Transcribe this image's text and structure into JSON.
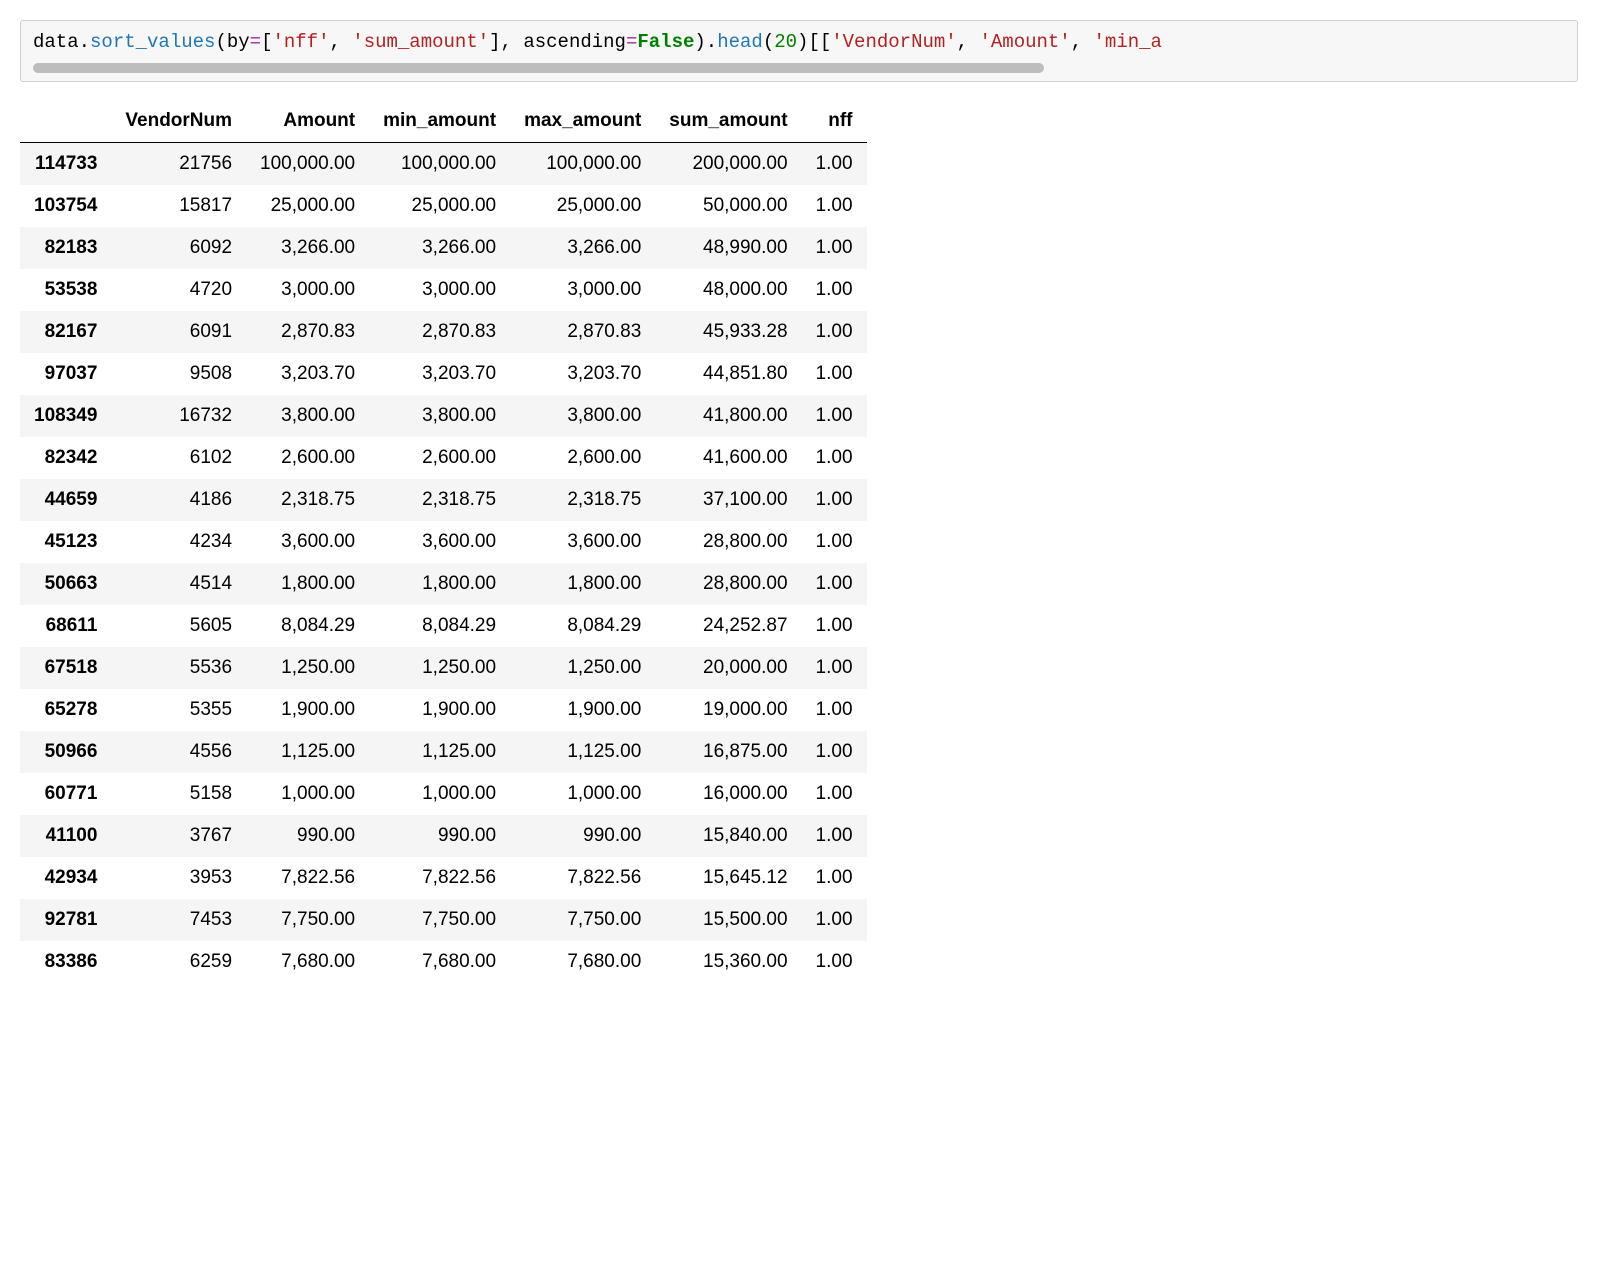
{
  "code": {
    "t_data": "data",
    "t_dot1": ".",
    "t_sort": "sort_values",
    "t_paren1": "(",
    "t_by": "by",
    "t_eq1": "=",
    "t_list1_open": "[",
    "t_str_nff": "'nff'",
    "t_comma1": ", ",
    "t_str_sum": "'sum_amount'",
    "t_list1_close": "]",
    "t_comma2": ", ",
    "t_asc": "ascending",
    "t_eq2": "=",
    "t_false": "False",
    "t_paren1c": ")",
    "t_dot2": ".",
    "t_head": "head",
    "t_paren2": "(",
    "t_20": "20",
    "t_paren2c": ")",
    "t_sel_open": "[[",
    "t_str_vn": "'VendorNum'",
    "t_comma3": ", ",
    "t_str_amt": "'Amount'",
    "t_comma4": ", ",
    "t_str_mina": "'min_a"
  },
  "table": {
    "columns": [
      "VendorNum",
      "Amount",
      "min_amount",
      "max_amount",
      "sum_amount",
      "nff"
    ],
    "rows": [
      {
        "idx": "114733",
        "VendorNum": "21756",
        "Amount": "100,000.00",
        "min_amount": "100,000.00",
        "max_amount": "100,000.00",
        "sum_amount": "200,000.00",
        "nff": "1.00"
      },
      {
        "idx": "103754",
        "VendorNum": "15817",
        "Amount": "25,000.00",
        "min_amount": "25,000.00",
        "max_amount": "25,000.00",
        "sum_amount": "50,000.00",
        "nff": "1.00"
      },
      {
        "idx": "82183",
        "VendorNum": "6092",
        "Amount": "3,266.00",
        "min_amount": "3,266.00",
        "max_amount": "3,266.00",
        "sum_amount": "48,990.00",
        "nff": "1.00"
      },
      {
        "idx": "53538",
        "VendorNum": "4720",
        "Amount": "3,000.00",
        "min_amount": "3,000.00",
        "max_amount": "3,000.00",
        "sum_amount": "48,000.00",
        "nff": "1.00"
      },
      {
        "idx": "82167",
        "VendorNum": "6091",
        "Amount": "2,870.83",
        "min_amount": "2,870.83",
        "max_amount": "2,870.83",
        "sum_amount": "45,933.28",
        "nff": "1.00"
      },
      {
        "idx": "97037",
        "VendorNum": "9508",
        "Amount": "3,203.70",
        "min_amount": "3,203.70",
        "max_amount": "3,203.70",
        "sum_amount": "44,851.80",
        "nff": "1.00"
      },
      {
        "idx": "108349",
        "VendorNum": "16732",
        "Amount": "3,800.00",
        "min_amount": "3,800.00",
        "max_amount": "3,800.00",
        "sum_amount": "41,800.00",
        "nff": "1.00"
      },
      {
        "idx": "82342",
        "VendorNum": "6102",
        "Amount": "2,600.00",
        "min_amount": "2,600.00",
        "max_amount": "2,600.00",
        "sum_amount": "41,600.00",
        "nff": "1.00"
      },
      {
        "idx": "44659",
        "VendorNum": "4186",
        "Amount": "2,318.75",
        "min_amount": "2,318.75",
        "max_amount": "2,318.75",
        "sum_amount": "37,100.00",
        "nff": "1.00"
      },
      {
        "idx": "45123",
        "VendorNum": "4234",
        "Amount": "3,600.00",
        "min_amount": "3,600.00",
        "max_amount": "3,600.00",
        "sum_amount": "28,800.00",
        "nff": "1.00"
      },
      {
        "idx": "50663",
        "VendorNum": "4514",
        "Amount": "1,800.00",
        "min_amount": "1,800.00",
        "max_amount": "1,800.00",
        "sum_amount": "28,800.00",
        "nff": "1.00"
      },
      {
        "idx": "68611",
        "VendorNum": "5605",
        "Amount": "8,084.29",
        "min_amount": "8,084.29",
        "max_amount": "8,084.29",
        "sum_amount": "24,252.87",
        "nff": "1.00"
      },
      {
        "idx": "67518",
        "VendorNum": "5536",
        "Amount": "1,250.00",
        "min_amount": "1,250.00",
        "max_amount": "1,250.00",
        "sum_amount": "20,000.00",
        "nff": "1.00"
      },
      {
        "idx": "65278",
        "VendorNum": "5355",
        "Amount": "1,900.00",
        "min_amount": "1,900.00",
        "max_amount": "1,900.00",
        "sum_amount": "19,000.00",
        "nff": "1.00"
      },
      {
        "idx": "50966",
        "VendorNum": "4556",
        "Amount": "1,125.00",
        "min_amount": "1,125.00",
        "max_amount": "1,125.00",
        "sum_amount": "16,875.00",
        "nff": "1.00"
      },
      {
        "idx": "60771",
        "VendorNum": "5158",
        "Amount": "1,000.00",
        "min_amount": "1,000.00",
        "max_amount": "1,000.00",
        "sum_amount": "16,000.00",
        "nff": "1.00"
      },
      {
        "idx": "41100",
        "VendorNum": "3767",
        "Amount": "990.00",
        "min_amount": "990.00",
        "max_amount": "990.00",
        "sum_amount": "15,840.00",
        "nff": "1.00"
      },
      {
        "idx": "42934",
        "VendorNum": "3953",
        "Amount": "7,822.56",
        "min_amount": "7,822.56",
        "max_amount": "7,822.56",
        "sum_amount": "15,645.12",
        "nff": "1.00"
      },
      {
        "idx": "92781",
        "VendorNum": "7453",
        "Amount": "7,750.00",
        "min_amount": "7,750.00",
        "max_amount": "7,750.00",
        "sum_amount": "15,500.00",
        "nff": "1.00"
      },
      {
        "idx": "83386",
        "VendorNum": "6259",
        "Amount": "7,680.00",
        "min_amount": "7,680.00",
        "max_amount": "7,680.00",
        "sum_amount": "15,360.00",
        "nff": "1.00"
      }
    ]
  }
}
